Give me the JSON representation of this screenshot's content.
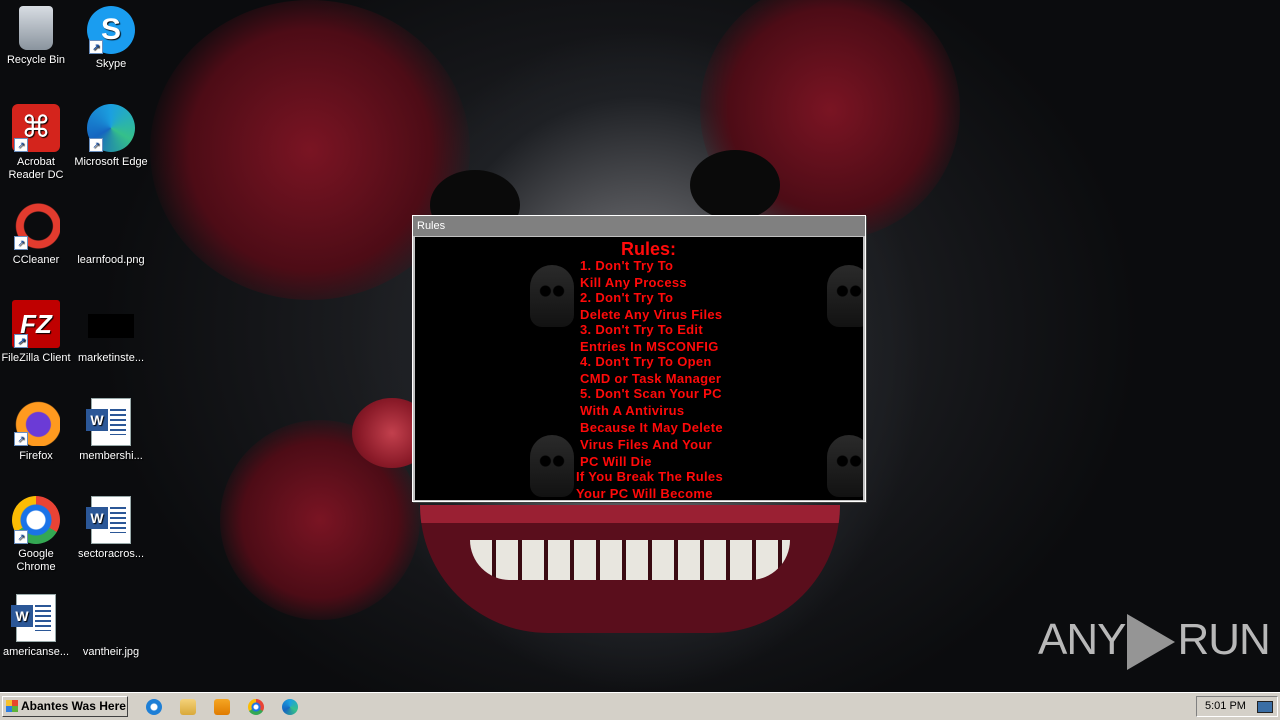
{
  "desktop": {
    "icons": [
      {
        "label": "Recycle Bin",
        "icon": "recycle-bin-icon"
      },
      {
        "label": "Skype",
        "icon": "skype-icon"
      },
      {
        "label": "Acrobat Reader DC",
        "icon": "acrobat-icon"
      },
      {
        "label": "Microsoft Edge",
        "icon": "edge-icon"
      },
      {
        "label": "CCleaner",
        "icon": "ccleaner-icon"
      },
      {
        "label": "learnfood.png",
        "icon": "image-file-icon"
      },
      {
        "label": "FileZilla Client",
        "icon": "filezilla-icon"
      },
      {
        "label": "marketinste...",
        "icon": "file-icon"
      },
      {
        "label": "Firefox",
        "icon": "firefox-icon"
      },
      {
        "label": "membershi...",
        "icon": "word-document-icon"
      },
      {
        "label": "Google Chrome",
        "icon": "chrome-icon"
      },
      {
        "label": "sectoracros...",
        "icon": "word-document-icon"
      },
      {
        "label": "americanse...",
        "icon": "word-document-icon"
      },
      {
        "label": "vantheir.jpg",
        "icon": "image-file-icon"
      }
    ]
  },
  "rules_window": {
    "title": "Rules",
    "heading": "Rules:",
    "lines": [
      "1. Don't Try To",
      "Kill Any Process",
      "2. Don't Try To",
      "Delete Any Virus Files",
      "3. Don't Try To Edit",
      "Entries In MSCONFIG",
      "4. Don't Try To Open",
      "CMD or Task Manager",
      "5. Don't Scan Your PC",
      "With A Antivirus",
      "Because It May Delete",
      "Virus Files And Your",
      "PC Will Die",
      "If You Break The Rules",
      "Your PC Will Become"
    ],
    "text_color": "#ff0a0a"
  },
  "taskbar": {
    "start_label": "Abantes Was Here",
    "pinned": [
      "internet-explorer-icon",
      "file-explorer-icon",
      "media-player-icon",
      "chrome-icon",
      "edge-icon"
    ],
    "clock": "5:01 PM"
  },
  "watermark": {
    "left": "ANY",
    "right": "RUN"
  }
}
